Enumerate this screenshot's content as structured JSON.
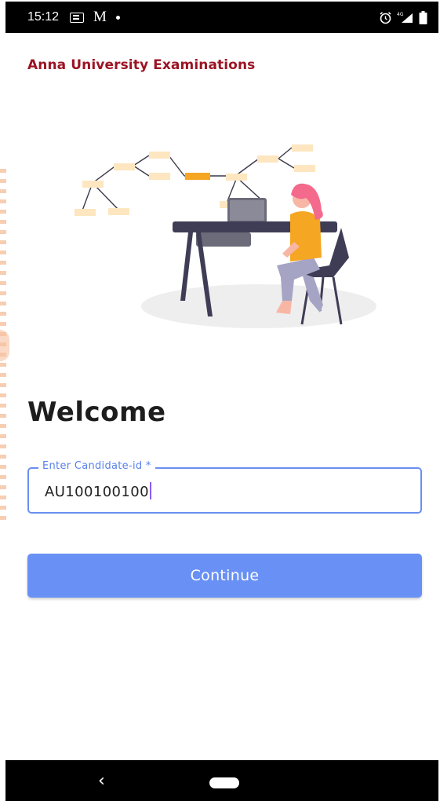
{
  "status_bar": {
    "time": "15:12",
    "icons": [
      "outlook-icon",
      "gmail-icon",
      "notification-dot-icon",
      "alarm-icon",
      "4g-signal-icon",
      "battery-icon"
    ]
  },
  "header": {
    "brand_title": "Anna University Examinations"
  },
  "main": {
    "welcome_heading": "Welcome",
    "candidate_field": {
      "label": "Enter Candidate-id *",
      "value": "AU100100100"
    },
    "continue_label": "Continue"
  },
  "nav_bar": {
    "back_glyph": "‹"
  },
  "colors": {
    "brand": "#9b1423",
    "accent": "#6890f5",
    "field_border": "#6a8ff0",
    "heading": "#1d1d1d"
  }
}
